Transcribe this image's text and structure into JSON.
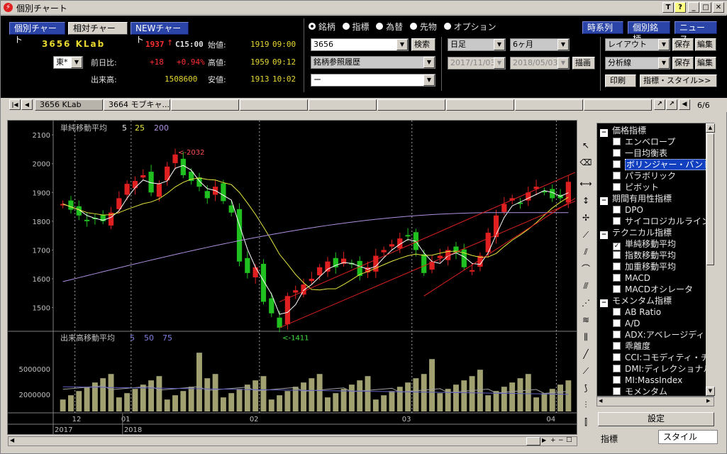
{
  "window": {
    "title": "個別チャート",
    "buttons": [
      "T",
      "?",
      "_",
      "□",
      "✕"
    ]
  },
  "nav": {
    "individual_chart": "個別チャート",
    "relative_chart": "相対チャート",
    "new_chart": "NEWチャート"
  },
  "stock": {
    "code_name": "3656 KLab",
    "price": "1937",
    "arrow": "↑",
    "time_flag": "C15:00",
    "market": "東*",
    "change_label": "前日比:",
    "change": "+18",
    "change_pct": "+0.94%",
    "volume_label": "出来高:",
    "volume": "1508600",
    "open_label": "始値:",
    "open": "1919",
    "open_time": "09:00",
    "high_label": "高値:",
    "high": "1959",
    "high_time": "09:12",
    "low_label": "安値:",
    "low": "1913",
    "low_time": "10:02"
  },
  "asset_types": [
    {
      "label": "銘柄",
      "selected": true
    },
    {
      "label": "指標",
      "selected": false
    },
    {
      "label": "為替",
      "selected": false
    },
    {
      "label": "先物",
      "selected": false
    },
    {
      "label": "オプション",
      "selected": false
    }
  ],
  "controls": {
    "symbol_input": "3656",
    "search_button": "検索",
    "history_select": "銘柄参照履歴",
    "blank_select": "ー",
    "period_select": "日足",
    "range_select": "6ヶ月",
    "date_from": "2017/11/03",
    "date_to": "2018/05/03",
    "draw_button": "描画",
    "time_series_button": "時系列",
    "individual_symbol_button": "個別銘柄",
    "news_button": "ニュース",
    "layout_select": "レイアウト",
    "save_button": "保存",
    "edit_button": "編集",
    "analysis_select": "分析線",
    "save_button2": "保存",
    "edit_button2": "編集",
    "print_button": "印刷",
    "indicator_style_button": "指標・スタイル>>"
  },
  "tabs": {
    "items": [
      "3656 KLab",
      "3664 モブキャ..."
    ],
    "page": "6/6"
  },
  "chart_data": {
    "type": "line",
    "title": "単純移動平均",
    "price_panel": {
      "label": "単純移動平均",
      "ma_periods": [
        "5",
        "25",
        "200"
      ],
      "ylim": [
        1420,
        2130
      ],
      "yticks": [
        1500,
        1600,
        1700,
        1800,
        1900,
        2000,
        2100
      ],
      "annotations": [
        {
          "text": "<-2032",
          "value": 2032
        },
        {
          "text": "<-1411",
          "value": 1411
        }
      ],
      "close_approx": [
        1860,
        1840,
        1820,
        1800,
        1810,
        1800,
        1830,
        1880,
        1930,
        1940,
        1960,
        1900,
        1930,
        1990,
        2032,
        1960,
        1940,
        1920,
        1880,
        1920,
        1870,
        1830,
        1660,
        1620,
        1640,
        1520,
        1480,
        1430,
        1540,
        1560,
        1580,
        1600,
        1640,
        1660,
        1640,
        1670,
        1650,
        1610,
        1640,
        1680,
        1700,
        1720,
        1740,
        1750,
        1700,
        1620,
        1660,
        1680,
        1700,
        1690,
        1640,
        1630,
        1680,
        1760,
        1820,
        1860,
        1880,
        1860,
        1900,
        1920,
        1900,
        1880,
        1880,
        1937
      ],
      "ma200_range": [
        1590,
        1830
      ],
      "colors": {
        "up": "#e02020",
        "down": "#20c020",
        "ma5": "#ffffff",
        "ma25": "#e8e840",
        "ma200": "#b090e0",
        "trend": "#e02020"
      }
    },
    "volume_panel": {
      "label": "出来高移動平均",
      "ma_periods": [
        "5",
        "50",
        "75"
      ],
      "yticks": [
        2000000,
        5000000
      ],
      "bar_color": "#a0a070"
    },
    "x_ticks": [
      "12",
      "01",
      "02",
      "03",
      "04"
    ],
    "x_years": [
      "2017",
      "2018"
    ]
  },
  "indicators": {
    "items": [
      {
        "label": "価格指標",
        "group": true
      },
      {
        "label": "エンベロープ"
      },
      {
        "label": "一目均衡表"
      },
      {
        "label": "ボリンジャー・バンド",
        "highlight": true
      },
      {
        "label": "パラボリック"
      },
      {
        "label": "ピボット"
      },
      {
        "label": "期間有用性指標",
        "group": true
      },
      {
        "label": "DPO"
      },
      {
        "label": "サイコロジカルライン"
      },
      {
        "label": "テクニカル指標",
        "group": true
      },
      {
        "label": "単純移動平均",
        "checked": true
      },
      {
        "label": "指数移動平均"
      },
      {
        "label": "加重移動平均"
      },
      {
        "label": "MACD"
      },
      {
        "label": "MACDオシレータ"
      },
      {
        "label": "モメンタム指標",
        "group": true
      },
      {
        "label": "AB Ratio"
      },
      {
        "label": "A/D"
      },
      {
        "label": "ADX:アベレージディレ"
      },
      {
        "label": "乖離度"
      },
      {
        "label": "CCI:コモディティ・チャ"
      },
      {
        "label": "DMI:ディレクショナル"
      },
      {
        "label": "MI:MassIndex"
      },
      {
        "label": "モメンタム"
      }
    ],
    "settings_button": "設定",
    "tab_indicator": "指標",
    "tab_style": "スタイル"
  }
}
